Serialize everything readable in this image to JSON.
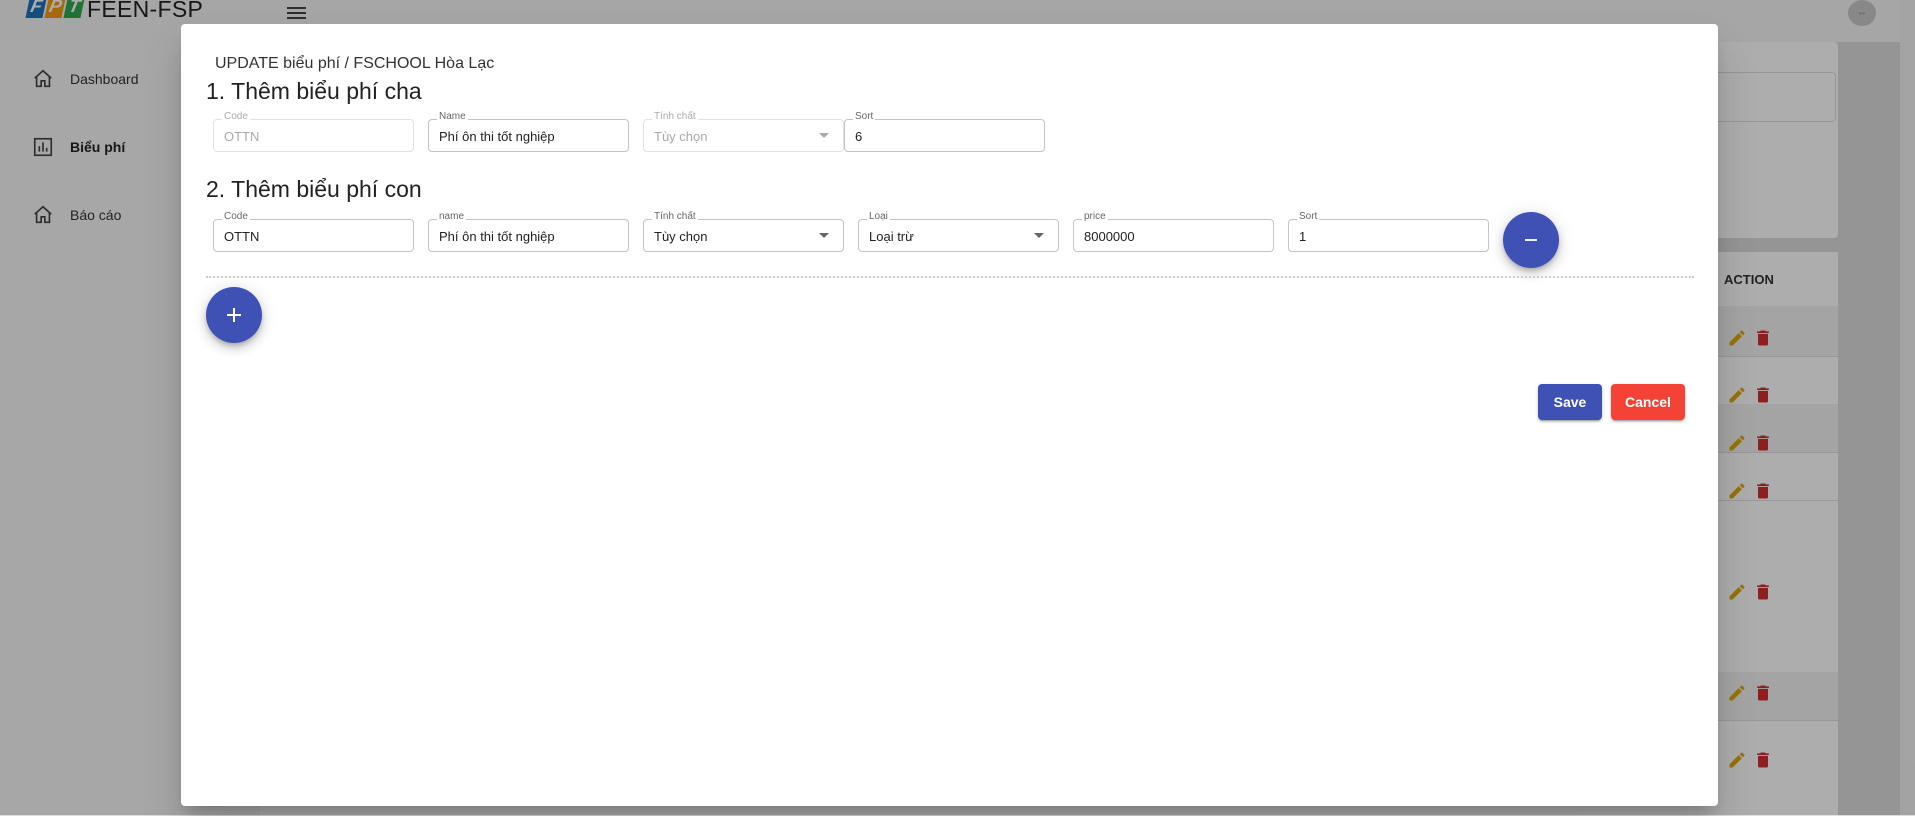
{
  "app": {
    "title": "FEEN-FSP",
    "logo_letters": [
      "F",
      "P",
      "T"
    ]
  },
  "sidebar": {
    "items": [
      {
        "label": "Dashboard",
        "icon": "home-icon"
      },
      {
        "label": "Biểu phí",
        "icon": "chart-icon",
        "active": true
      },
      {
        "label": "Báo cáo",
        "icon": "home-icon"
      }
    ]
  },
  "table": {
    "action_header": "ACTION"
  },
  "modal": {
    "breadcrumb": "UPDATE biểu phí / FSCHOOL Hòa Lạc",
    "section1": {
      "title": "1. Thêm biểu phí cha",
      "fields": {
        "code": {
          "label": "Code",
          "value": "OTTN"
        },
        "name": {
          "label": "Name",
          "value": "Phí ôn thi tốt nghiệp"
        },
        "tinh_chat": {
          "label": "Tính chất",
          "value": "Tùy chọn"
        },
        "sort": {
          "label": "Sort",
          "value": "6"
        }
      }
    },
    "section2": {
      "title": "2. Thêm biểu phí con",
      "fields": {
        "code": {
          "label": "Code",
          "value": "OTTN"
        },
        "name": {
          "label": "name",
          "value": "Phí ôn thi tốt nghiệp"
        },
        "tinh_chat": {
          "label": "Tính chất",
          "value": "Tùy chọn"
        },
        "loai": {
          "label": "Loại",
          "value": "Loại trừ"
        },
        "price": {
          "label": "price",
          "value": "8000000"
        },
        "sort": {
          "label": "Sort",
          "value": "1"
        }
      }
    },
    "remove_icon": "minus-icon",
    "add_icon": "plus-icon",
    "save_label": "Save",
    "cancel_label": "Cancel"
  },
  "colors": {
    "primary": "#3f51b5",
    "danger": "#f44336",
    "edit": "#e0a800",
    "delete": "#d32f2f"
  }
}
